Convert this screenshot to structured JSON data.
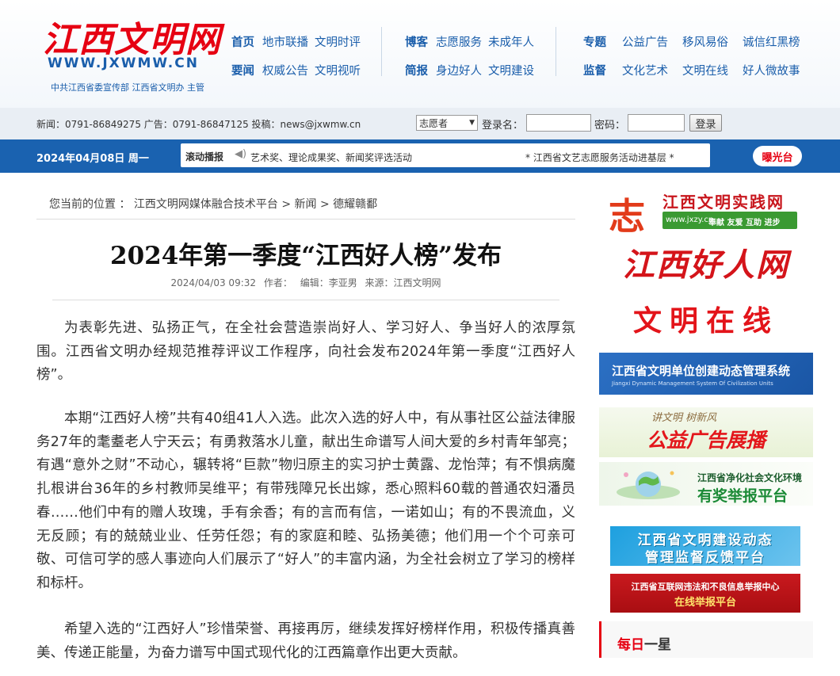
{
  "header": {
    "logo_title": "江西文明网",
    "logo_url": "WWW.JXWMW.CN",
    "logo_sub": "中共江西省委宣传部  江西省文明办 主管",
    "nav_groups": [
      {
        "row1": {
          "key": "首页",
          "items": [
            "地市联播",
            "文明时评"
          ]
        },
        "row2": {
          "key": "要闻",
          "items": [
            "权威公告",
            "文明视听"
          ]
        }
      },
      {
        "row1": {
          "key": "博客",
          "items": [
            "志愿服务",
            "未成年人"
          ]
        },
        "row2": {
          "key": "简报",
          "items": [
            "身边好人",
            "文明建设"
          ]
        }
      },
      {
        "row1": {
          "key": "专题",
          "items": [
            "公益广告",
            "移风易俗",
            "诚信红黑榜"
          ]
        },
        "row2": {
          "key": "监督",
          "items": [
            "文化艺术",
            "文明在线",
            "好人微故事"
          ]
        }
      }
    ]
  },
  "login_bar": {
    "contact": "新闻：0791-86849275   广告：0791-86847125   投稿：news@jxwmw.cn",
    "user_type": "志愿者",
    "username_label": "登录名：",
    "password_label": "密码：",
    "login_button": "登录"
  },
  "blue_bar": {
    "date": "2024年04月08日 周一",
    "ticker_label": "滚动播报",
    "ticker_items": [
      "艺术奖、理论成果奖、新闻奖评选活动",
      "* 江西省文艺志愿服务活动进基层 *"
    ],
    "expose_button": "曝光台"
  },
  "article": {
    "breadcrumb": "您当前的位置 ： 江西文明网媒体融合技术平台 > 新闻 > 德耀赣鄱",
    "title": "2024年第一季度“江西好人榜”发布",
    "meta": {
      "date": "2024/04/03 09:32",
      "author": "作者：",
      "editor": "编辑：李亚男",
      "source": "来源：江西文明网"
    },
    "paragraphs": [
      "为表彰先进、弘扬正气，在全社会营造崇尚好人、学习好人、争当好人的浓厚氛围。江西省文明办经规范推荐评议工作程序，向社会发布2024年第一季度“江西好人榜”。",
      "本期“江西好人榜”共有40组41人入选。此次入选的好人中，有从事社区公益法律服务27年的耄耋老人宁天云；有勇救落水儿童，献出生命谱写人间大爱的乡村青年邹亮；有遇“意外之财”不动心，辗转将“巨款”物归原主的实习护士黄露、龙怡萍；有不惧病魔扎根讲台36年的乡村教师吴维平；有带残障兄长出嫁，悉心照料60载的普通农妇潘员春……他们中有的赠人玫瑰，手有余香；有的言而有信，一诺如山；有的不畏流血，义无反顾；有的兢兢业业、任劳任怨；有的家庭和睦、弘扬美德；他们用一个个可亲可敬、可信可学的感人事迹向人们展示了“好人”的丰富内涵，为全社会树立了学习的榜样和标杆。",
      "希望入选的“江西好人”珍惜荣誉、再接再厉，继续发挥好榜样作用，积极传播真善美、传递正能量，为奋力谱写中国式现代化的江西篇章作出更大贡献。"
    ]
  },
  "sidebar": {
    "banner1": {
      "mark": "志",
      "title": "江西文明实践网",
      "url": "www.jxzy.cn",
      "slogan": "奉献 友爱 互助 进步"
    },
    "banner2": {
      "title": "江西好人网"
    },
    "banner3": {
      "title": "文明在线"
    },
    "banner4": {
      "title": "江西省文明单位创建动态管理系统",
      "sub": "Jiangxi Dynamic Management System Of Civilization Units"
    },
    "banner5": {
      "top": "讲文明 树新风",
      "title": "公益广告展播"
    },
    "banner6": {
      "top": "江西省净化社会文化环境",
      "title": "有奖举报平台"
    },
    "banner7": {
      "line1": "江西省文明建设动态",
      "line2": "管理监督反馈平台"
    },
    "banner8": {
      "line1": "江西省互联网违法和不良信息举报中心",
      "line2": "在线举报平台"
    },
    "daily_star": {
      "red": "每日",
      "dark": "一星"
    }
  },
  "colors": {
    "brand_red": "#e60012",
    "brand_blue": "#1a62b0",
    "nav_blue": "#1a5eab"
  }
}
